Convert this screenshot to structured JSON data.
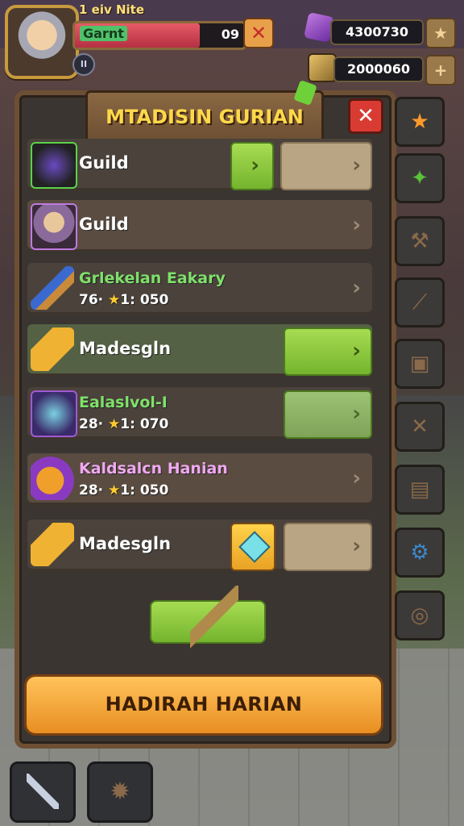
{
  "hud": {
    "level_label": "1 еiv Nite",
    "player_name": "Garnt",
    "hp_value": "09",
    "hp_fraction": 0.74,
    "pause_label": "II",
    "gems": "4300730",
    "gold": "2000060"
  },
  "panel": {
    "title": "MTADISIN GURIAN"
  },
  "rows": [
    {
      "name": "Guild",
      "sub_prefix": "",
      "sub_value": ""
    },
    {
      "name": "Guild",
      "sub_prefix": "",
      "sub_value": ""
    },
    {
      "name": "Grlekelan Eakary",
      "sub_prefix": "76·",
      "sub_value": "1: 050"
    },
    {
      "name": "Madesgln",
      "sub_prefix": "",
      "sub_value": ""
    },
    {
      "name": "Ealaslvol-I",
      "sub_prefix": "28·",
      "sub_value": "1: 070"
    },
    {
      "name": "Kaldsalcn Hanian",
      "sub_prefix": "28·",
      "sub_value": "1: 050"
    },
    {
      "name": "Madesgln",
      "sub_prefix": "",
      "sub_value": ""
    }
  ],
  "claim_button": "HADIRAH HARIAN",
  "colors": {
    "accent_gold": "#ffd84a",
    "button_green": "#8fca40",
    "close_red": "#d93b32",
    "name_green": "#7fe06a",
    "name_pink": "#f0a8f0"
  },
  "icons": {
    "close": "close-icon",
    "favorite": "star-icon",
    "chevron": "chevron-right-icon"
  }
}
